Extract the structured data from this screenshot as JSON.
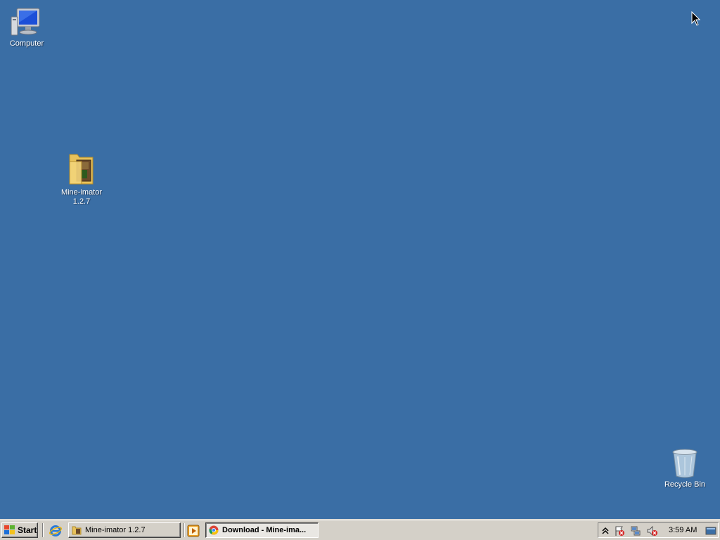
{
  "desktop": {
    "background_color": "#3a6ea5",
    "icons": [
      {
        "label": "Computer",
        "icon": "computer-icon"
      },
      {
        "label_line1": "Mine-imator",
        "label_line2": "1.2.7",
        "icon": "folder-icon"
      },
      {
        "label": "Recycle Bin",
        "icon": "recycle-bin-icon"
      }
    ]
  },
  "taskbar": {
    "start_label": "Start",
    "quick_launch": [
      {
        "icon": "internet-explorer-icon"
      },
      {
        "icon": "media-player-icon"
      }
    ],
    "tasks": [
      {
        "label": "Mine-imator 1.2.7",
        "icon": "folder-icon",
        "active": false
      },
      {
        "label": "Download - Mine-ima...",
        "icon": "chrome-icon",
        "active": true
      }
    ],
    "tray": {
      "icons": [
        "show-hidden-icons-chevron",
        "action-center-flag-icon",
        "network-icon",
        "volume-muted-icon"
      ],
      "clock": "3:59 AM",
      "show_desktop_icon": "show-desktop-icon"
    }
  }
}
